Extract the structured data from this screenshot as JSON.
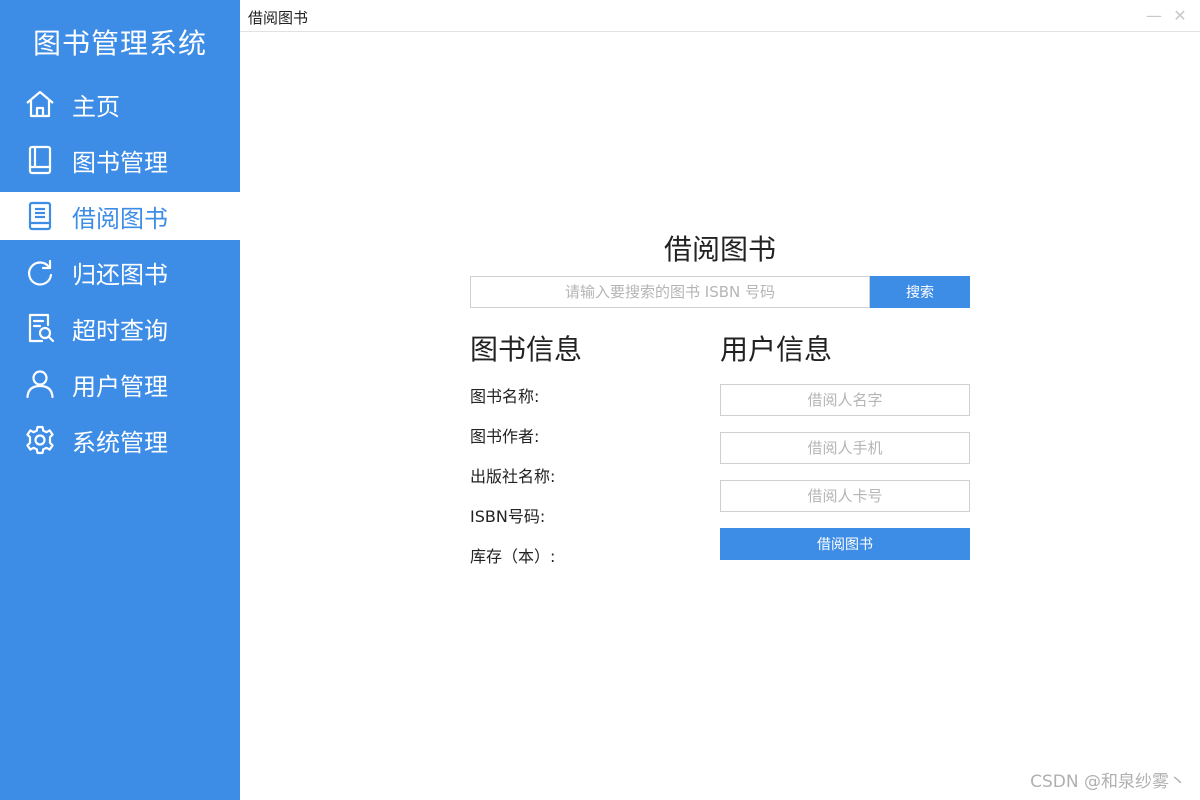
{
  "app": {
    "title": "图书管理系统",
    "accent_color": "#3d8ce6"
  },
  "sidebar": {
    "items": [
      {
        "label": "主页",
        "icon": "home-icon",
        "active": false
      },
      {
        "label": "图书管理",
        "icon": "book-icon",
        "active": false
      },
      {
        "label": "借阅图书",
        "icon": "borrow-book-icon",
        "active": true
      },
      {
        "label": "归还图书",
        "icon": "return-icon",
        "active": false
      },
      {
        "label": "超时查询",
        "icon": "overdue-search-icon",
        "active": false
      },
      {
        "label": "用户管理",
        "icon": "user-icon",
        "active": false
      },
      {
        "label": "系统管理",
        "icon": "gear-icon",
        "active": false
      }
    ]
  },
  "window": {
    "title": "借阅图书",
    "minimize_label": "—",
    "close_label": "✕"
  },
  "main": {
    "panel_title": "借阅图书",
    "search": {
      "placeholder": "请输入要搜索的图书 ISBN 号码",
      "value": "",
      "button_label": "搜索"
    },
    "book_info": {
      "heading": "图书信息",
      "fields": [
        {
          "label": "图书名称:"
        },
        {
          "label": "图书作者:"
        },
        {
          "label": "出版社名称:"
        },
        {
          "label": "ISBN号码:"
        },
        {
          "label": "库存（本）:"
        }
      ]
    },
    "user_info": {
      "heading": "用户信息",
      "fields": [
        {
          "placeholder": "借阅人名字",
          "value": ""
        },
        {
          "placeholder": "借阅人手机",
          "value": ""
        },
        {
          "placeholder": "借阅人卡号",
          "value": ""
        }
      ],
      "button_label": "借阅图书"
    }
  },
  "watermark": "CSDN @和泉纱雾丶"
}
